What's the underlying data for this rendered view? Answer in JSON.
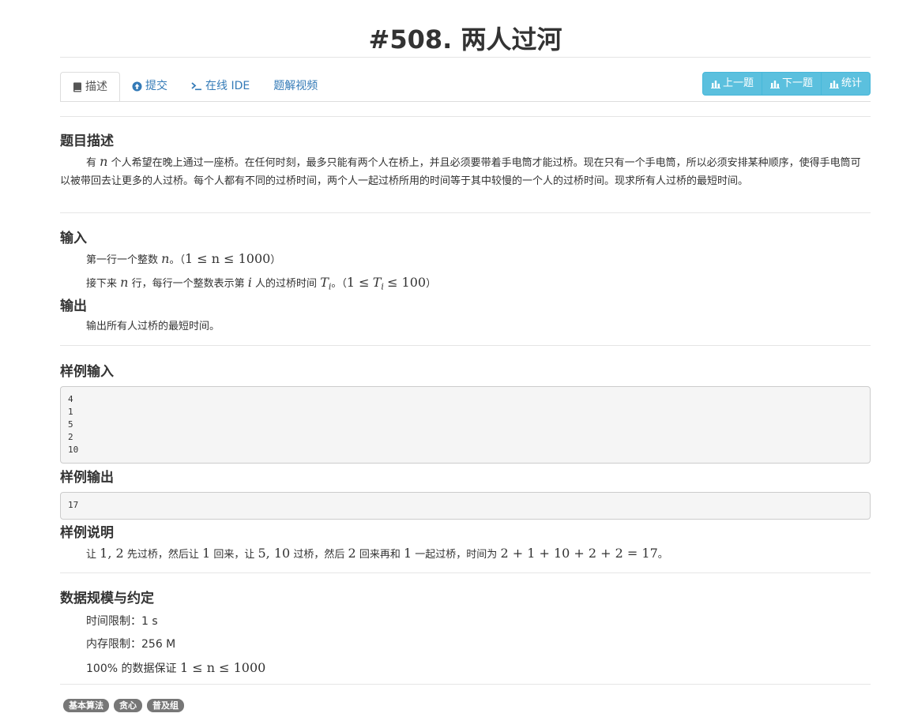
{
  "title": "#508. 两人过河",
  "tabs": [
    {
      "label": "描述",
      "icon": "book-icon"
    },
    {
      "label": "提交",
      "icon": "upload-circle-icon"
    },
    {
      "label": "在线 IDE",
      "icon": "terminal-icon"
    },
    {
      "label": "题解视频",
      "icon": ""
    }
  ],
  "nav_buttons": [
    {
      "label": "上一题",
      "icon": "bar-chart-icon"
    },
    {
      "label": "下一题",
      "icon": "bar-chart-icon"
    },
    {
      "label": "统计",
      "icon": "bar-chart-icon"
    }
  ],
  "description": {
    "heading": "题目描述",
    "p1_lead": "有",
    "var_n": "n",
    "p1_rest": "个人希望在晚上通过一座桥。在任何时刻，最多只能有两个人在桥上，并且必须要带着手电筒才能过桥。现在只有一个手电筒，所以必须安排某种顺序，使得手电筒可以被带回去让更多的人过桥。每个人都有不同的过桥时间，两个人一起过桥所用的时间等于其中较慢的一个人的过桥时间。现求所有人过桥的最短时间。"
  },
  "input": {
    "heading": "输入",
    "line1_a": "第一行一个整数",
    "line1_var": "n",
    "line1_b": "。（",
    "line1_math": "1 ≤ n ≤ 1000",
    "line1_c": "）",
    "line2_a": "接下来",
    "line2_var_n": "n",
    "line2_b": "行，每行一个整数表示第",
    "line2_var_i": "i",
    "line2_c": "人的过桥时间",
    "line2_var_T": "T",
    "line2_sub": "i",
    "line2_d": "。（",
    "line2_math_a": "1 ≤",
    "line2_math_T": "T",
    "line2_math_sub": "i",
    "line2_math_b": "≤ 100",
    "line2_e": "）"
  },
  "output": {
    "heading": "输出",
    "text": "输出所有人过桥的最短时间。"
  },
  "sample_input": {
    "heading": "样例输入",
    "lines": [
      "4",
      "1",
      "5",
      "2",
      "10"
    ]
  },
  "sample_output": {
    "heading": "样例输出",
    "lines": [
      "17"
    ]
  },
  "explanation": {
    "heading": "样例说明",
    "t1": "让",
    "m1": "1, 2",
    "t2": "先过桥，然后让",
    "m2": "1",
    "t3": "回来，让",
    "m3": "5, 10",
    "t4": "过桥，然后",
    "m4": "2",
    "t5": "回来再和",
    "m5": "1",
    "t6": "一起过桥，时间为",
    "m6": "2 + 1 + 10 + 2 + 2 = 17",
    "t7": "。"
  },
  "constraints": {
    "heading": "数据规模与约定",
    "time_limit": "时间限制：1 s",
    "memory_limit": "内存限制：256 M",
    "guarantee_text": "100% 的数据保证",
    "guarantee_math": "1 ≤ n ≤ 1000"
  },
  "tags": [
    "基本算法",
    "贪心",
    "普及组"
  ]
}
